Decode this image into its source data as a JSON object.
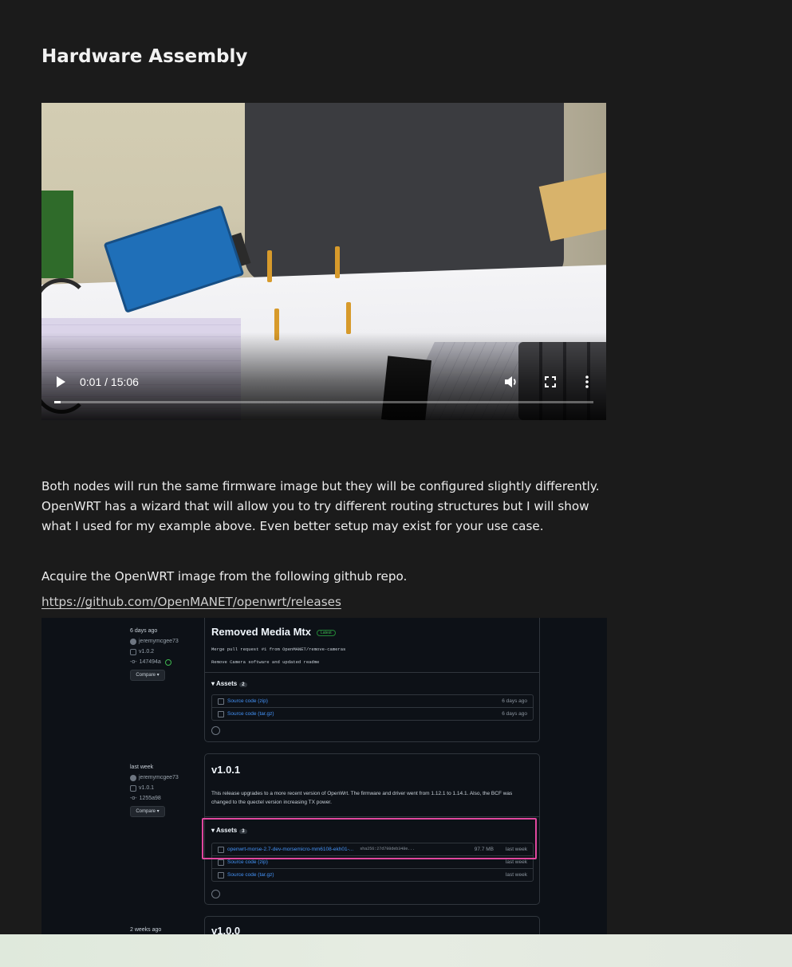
{
  "section": {
    "heading": "Hardware Assembly"
  },
  "video": {
    "time": "0:01 / 15:06",
    "progress_fraction": 0.012,
    "play_icon": "play-icon",
    "volume_icon": "volume-icon",
    "fullscreen_icon": "fullscreen-icon",
    "more_icon": "more-vertical-icon"
  },
  "body": {
    "paragraph1": "Both nodes will run the same firmware image but they will be configured slightly differently. OpenWRT has a wizard that will allow you to try different routing structures but I will show what I used for my example above. Even better setup may exist for your use case.",
    "paragraph2": "Acquire the OpenWRT image from the following github repo.",
    "repo_link": "https://github.com/OpenMANET/openwrt/releases"
  },
  "github": {
    "releases": [
      {
        "when": "6 days ago",
        "author": "jeremymcgee73",
        "tag": "v1.0.2",
        "commit": "147494a",
        "compare": "Compare",
        "title": "Removed Media Mtx",
        "badge": "Latest",
        "commit_msg": "Merge pull request #1 from OpenMANET/remove-cameras",
        "notes": "Remove Camera software and updated readme",
        "assets_label": "Assets",
        "assets_count": "2",
        "assets": [
          {
            "name": "Source code (zip)",
            "date": "6 days ago"
          },
          {
            "name": "Source code (tar.gz)",
            "date": "6 days ago"
          }
        ]
      },
      {
        "when": "last week",
        "author": "jeremymcgee73",
        "tag": "v1.0.1",
        "commit": "1255a98",
        "compare": "Compare",
        "title": "v1.0.1",
        "notes": "This release upgrades to a more recent version of OpenWrt. The firmware and driver went from 1.12.1 to 1.14.1. Also, the BCF was changed to the quectel version increasing TX power.",
        "assets_label": "Assets",
        "assets_count": "3",
        "assets": [
          {
            "name": "openwrt-morse-2.7-dev-morsemicro-mm6108-ekh01-...",
            "sha": "sha256:27d798deb348e...",
            "size": "97.7 MB",
            "date": "last week"
          },
          {
            "name": "Source code (zip)",
            "date": "last week"
          },
          {
            "name": "Source code (tar.gz)",
            "date": "last week"
          }
        ]
      },
      {
        "when": "2 weeks ago",
        "title": "v1.0.0"
      }
    ],
    "highlight_color": "#e0479e"
  },
  "colors": {
    "page_bg": "#1b1b1b",
    "github_bg": "#0d1117",
    "link_blue": "#4493f8"
  }
}
